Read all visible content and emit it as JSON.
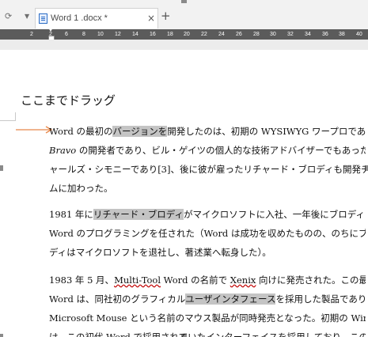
{
  "tab": {
    "title": "Word 1 .docx *",
    "close": "×",
    "new": "+"
  },
  "ruler": {
    "ticks": [
      "2",
      "2",
      "6",
      "8",
      "10",
      "12",
      "14",
      "16",
      "18",
      "20",
      "22",
      "24",
      "26",
      "28",
      "30",
      "32",
      "34",
      "36",
      "38",
      "40"
    ]
  },
  "annotation": {
    "text": "ここまでドラッグ"
  },
  "arrow_color": "#e8884a",
  "highlight_color": "#c4c4c4",
  "document": {
    "p1": {
      "l1a": "Word の最初の",
      "l1b": "バージョンを",
      "l1c": "開発したのは、初期の WYSIWYG ワープロである",
      "l2a": "Bravo",
      "l2b": " の開発者であり、ビル・ゲイツの個人的な技術アドバイザーでもあったチ",
      "l3": "ャールズ・シモニーであり[3]、後に彼が雇ったリチャード・ブロディも開発チー",
      "l4": "ムに加わった。"
    },
    "p2": {
      "l1a": "1981 年に",
      "l1b": "リチャード・ブロディ",
      "l1c": "がマイクロソフトに入社、一年後にブロディは",
      "l2": "Word のプログラミングを任された（Word は成功を収めたものの、のちにブロ",
      "l3": "ディはマイクロソフトを退社し、著述業へ転身した）。"
    },
    "p3": {
      "l1a": "1983 年 5 月、",
      "l1b": "Multi-Tool",
      "l1c": " Word の名前で ",
      "l1d": "Xenix",
      "l1e": " 向けに発売された。この最初の",
      "l2a": "Word は、同社初のグラフィカル",
      "l2b": "ユーザインタフェース",
      "l2c": "を採用した製品であり、",
      "l3": "Microsoft Mouse という名前のマウス製品が同時発売となった。初期の Windows",
      "l4": "け、この初代 Word で採用されていたインターフェイスを採用しており、この"
    }
  }
}
